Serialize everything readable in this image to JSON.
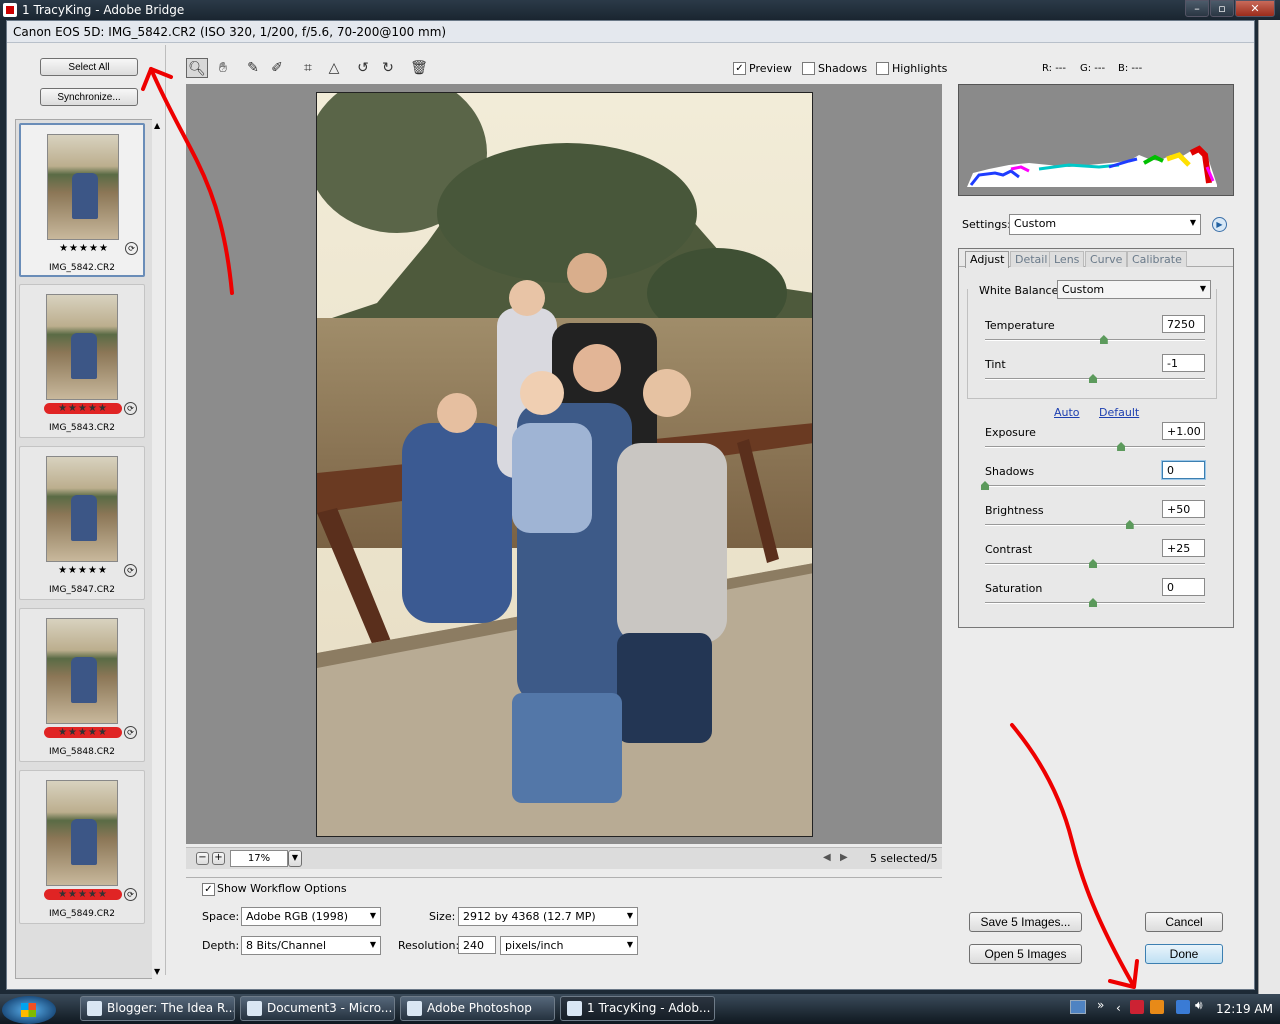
{
  "window": {
    "title": "1 TracyKing - Adobe Bridge"
  },
  "dialog": {
    "title": "Canon EOS 5D:  IMG_5842.CR2  (ISO 320, 1/200, f/5.6, 70-200@100 mm)"
  },
  "sidebar": {
    "select_all": "Select All",
    "synchronize": "Synchronize..."
  },
  "filmstrip": [
    {
      "name": "IMG_5842.CR2",
      "stars": "★★★★★",
      "red_label": false
    },
    {
      "name": "IMG_5843.CR2",
      "stars": "★★★★★",
      "red_label": true
    },
    {
      "name": "IMG_5847.CR2",
      "stars": "★★★★★",
      "red_label": false
    },
    {
      "name": "IMG_5848.CR2",
      "stars": "★★★★★",
      "red_label": true
    },
    {
      "name": "IMG_5849.CR2",
      "stars": "★★★★★",
      "red_label": true
    }
  ],
  "toolbar": {
    "tools": [
      "zoom-tool-icon",
      "hand-tool-icon",
      "white-balance-tool-icon",
      "color-sampler-tool-icon",
      "crop-tool-icon",
      "straighten-tool-icon",
      "rotate-left-icon",
      "rotate-right-icon",
      "delete-icon"
    ],
    "preview_label": "Preview",
    "preview_checked": true,
    "shadows_label": "Shadows",
    "shadows_checked": false,
    "highlights_label": "Highlights",
    "highlights_checked": false
  },
  "rgb_readout": {
    "r": "R: ---",
    "g": "G: ---",
    "b": "B: ---"
  },
  "zoom": {
    "minus": "−",
    "plus": "+",
    "value": "17%",
    "selected": "5 selected/5"
  },
  "workflow": {
    "show_label": "Show Workflow Options",
    "space_label": "Space:",
    "space_value": "Adobe RGB (1998)",
    "depth_label": "Depth:",
    "depth_value": "8 Bits/Channel",
    "size_label": "Size:",
    "size_value": "2912 by 4368  (12.7 MP)",
    "resolution_label": "Resolution:",
    "resolution_value": "240",
    "resolution_unit": "pixels/inch"
  },
  "settings": {
    "label": "Settings:",
    "value": "Custom"
  },
  "tabs": [
    "Adjust",
    "Detail",
    "Lens",
    "Curve",
    "Calibrate"
  ],
  "adjust": {
    "wb_label": "White Balance:",
    "wb_value": "Custom",
    "auto": "Auto",
    "default": "Default",
    "sliders": [
      {
        "label": "Temperature",
        "value": "7250",
        "fraction": 0.55
      },
      {
        "label": "Tint",
        "value": "-1",
        "fraction": 0.5
      },
      {
        "label": "Exposure",
        "value": "+1.00",
        "fraction": 0.63
      },
      {
        "label": "Shadows",
        "value": "0",
        "fraction": 0.0
      },
      {
        "label": "Brightness",
        "value": "+50",
        "fraction": 0.67
      },
      {
        "label": "Contrast",
        "value": "+25",
        "fraction": 0.5
      },
      {
        "label": "Saturation",
        "value": "0",
        "fraction": 0.5
      }
    ]
  },
  "buttons": {
    "save": "Save 5 Images...",
    "open": "Open 5 Images",
    "cancel": "Cancel",
    "done": "Done"
  },
  "taskbar": {
    "items": [
      "Blogger: The Idea R...",
      "Document3 - Micro...",
      "Adobe Photoshop",
      "1 TracyKing - Adob..."
    ],
    "clock": "12:19 AM"
  },
  "colors": {
    "annotation": "#e00000",
    "accent": "#3c7fb1"
  }
}
